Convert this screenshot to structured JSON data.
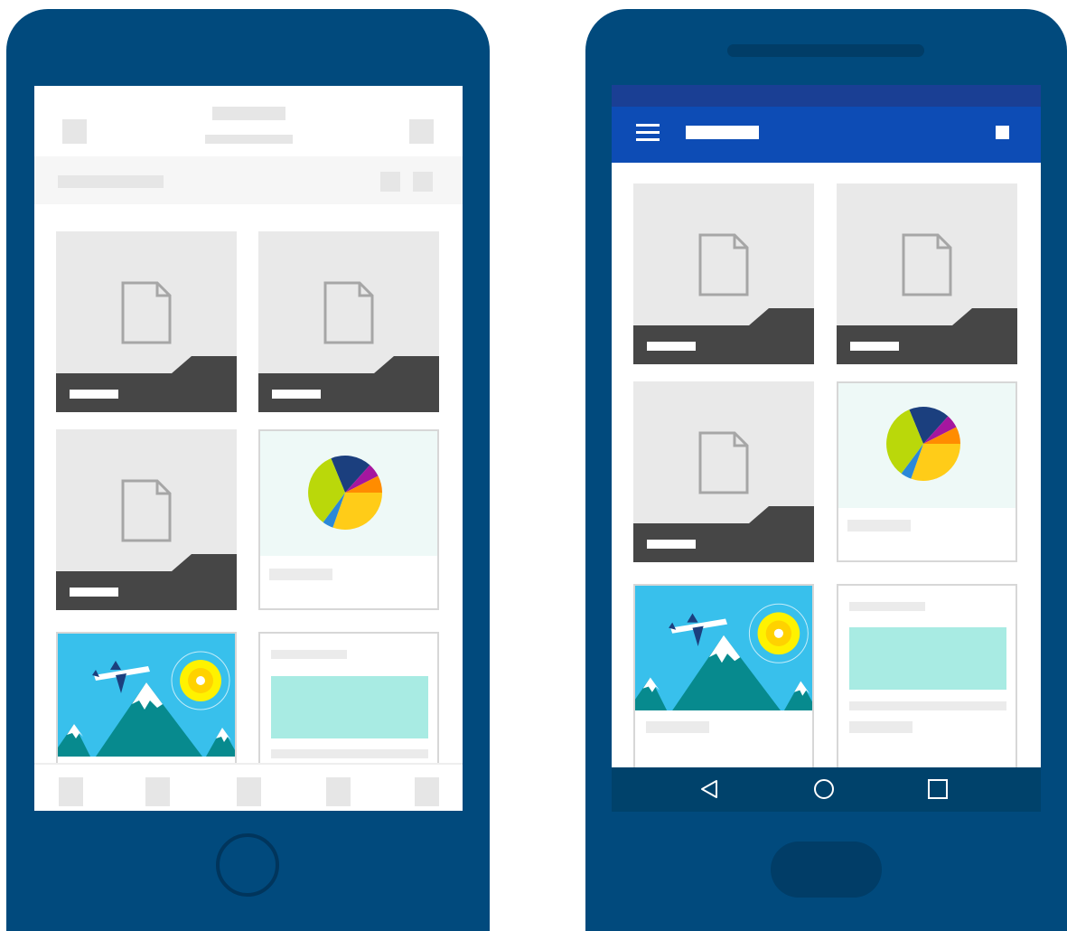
{
  "colors": {
    "phone_body": "#014a7d",
    "status_bar": "#1a3f94",
    "app_bar": "#0d4cb5",
    "nav_bar": "#00426b",
    "doc_bar": "#464646",
    "chart_bg": "#eef9f7",
    "teal_block": "#a8ebe3",
    "sky": "#38c0ec",
    "mountain": "#078a8e",
    "sun": "#fff200"
  },
  "pie_colors": [
    "#1b3f7e",
    "#a5169f",
    "#ff8c00",
    "#ffcc18",
    "#2b88d8",
    "#bad80a"
  ],
  "ios": {
    "header_icon_left": "placeholder-square",
    "header_icon_right": "placeholder-square",
    "tab_bar_items": 5,
    "tiles": [
      "document",
      "document",
      "document",
      "chart",
      "image",
      "text"
    ]
  },
  "android": {
    "app_bar_menu_icon": "hamburger-icon",
    "app_bar_action_icon": "square-icon",
    "nav_buttons": [
      "back-icon",
      "home-icon",
      "recents-icon"
    ],
    "tiles": [
      "document",
      "document",
      "document",
      "chart",
      "image",
      "text"
    ]
  }
}
